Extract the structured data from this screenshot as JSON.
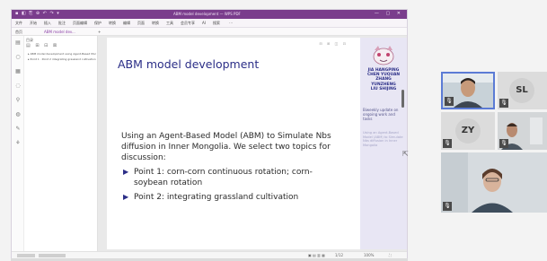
{
  "titlebar": {
    "quick_access": "▪ ◧ ⎘ ⊕ ↶ ↷ ▾",
    "title": "ABM model development — WPS PDF",
    "window_controls": "— ▢ ✕"
  },
  "menubar": {
    "items": [
      "文件",
      "开始",
      "插入",
      "批注",
      "页面编辑",
      "保护",
      "转换",
      "编辑",
      "页面",
      "转换",
      "工具",
      "会员专享",
      "AI",
      "搜索",
      "⋯"
    ]
  },
  "tabbar": {
    "items": [
      "首页",
      "ABM model dev...",
      "+"
    ]
  },
  "outline": {
    "header": "目录",
    "tools": "▤ ⊞ ⊟ ⊠",
    "rows": [
      "▸ ABM model development using Agent-Based Model",
      "▸ Point 1 · Point 2 integrating grassland cultivation"
    ]
  },
  "slide": {
    "toolbar": "⊟ ⊞ ◫ ⊡",
    "title": "ABM model development",
    "intro": "Using an Agent-Based Model (ABM) to Simulate Nbs diffusion in Inner Mongolia. We select two topics for discussion:",
    "bullets": [
      "Point 1: corn-corn continuous rotation; corn-soybean rotation",
      "Point 2: integrating grassland cultivation"
    ],
    "bullet_marker": "▶",
    "side": {
      "authors": "JIA HANGPING\nCHEN YUQUAN\nZHANG\nYUNZHENG\nLIU SHIJING",
      "meeting": "Biweekly update on ongoing work and tasks",
      "faded": "Using an Agent-Based Model (ABM) to Simulate Nbs diffusion in Inner Mongolia"
    }
  },
  "statusbar": {
    "page": "1/12",
    "zoom": "100%"
  },
  "participants": [
    {
      "initials": "",
      "kind": "video"
    },
    {
      "initials": "SL",
      "kind": "initials"
    },
    {
      "initials": "ZY",
      "kind": "initials"
    },
    {
      "initials": "",
      "kind": "video"
    },
    {
      "initials": "",
      "kind": "video"
    }
  ],
  "mic_icon": "🎙",
  "colors": {
    "titlebar": "#7a3d8c",
    "slide_title": "#2b2e87",
    "slide_sidebar": "#e8e6f4",
    "active_speaker_border": "#5b7bd5"
  }
}
